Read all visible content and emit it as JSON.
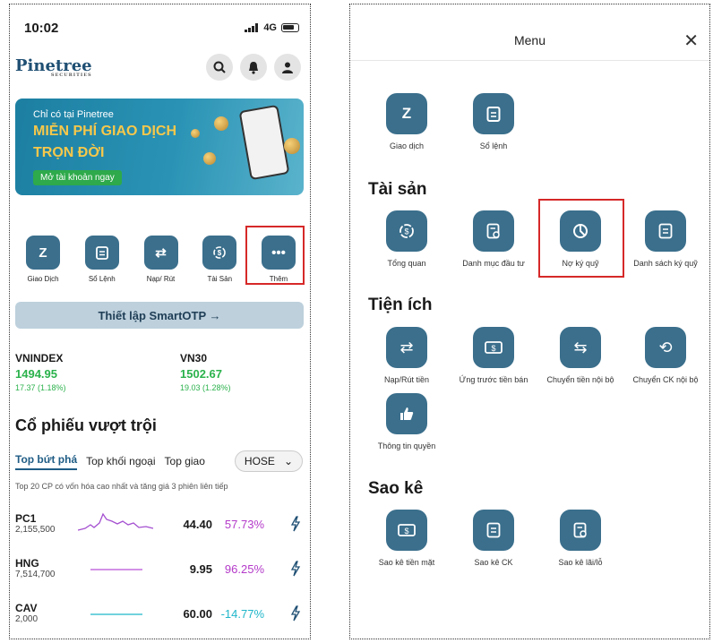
{
  "left": {
    "status_time": "10:02",
    "status_network": "4G",
    "logo": "Pinetree",
    "logo_sub": "SECURITIES",
    "banner": {
      "sub": "Chỉ có tại Pinetree",
      "line1": "MIỄN PHÍ GIAO DỊCH",
      "line2": "TRỌN ĐỜI",
      "cta": "Mở tài khoản ngay"
    },
    "quick_actions": [
      {
        "label": "Giao Dịch",
        "icon": "trade-icon"
      },
      {
        "label": "Sổ Lệnh",
        "icon": "orderbook-icon"
      },
      {
        "label": "Nạp/ Rút",
        "icon": "transfer-icon"
      },
      {
        "label": "Tài Sản",
        "icon": "asset-icon"
      },
      {
        "label": "Thêm",
        "icon": "more-icon"
      }
    ],
    "otp_button": "Thiết lập SmartOTP →",
    "indices": [
      {
        "name": "VNINDEX",
        "value": "1494.95",
        "change": "17.37 (1.18%)"
      },
      {
        "name": "VN30",
        "value": "1502.67",
        "change": "19.03 (1.28%)"
      }
    ],
    "section_title": "Cổ phiếu vượt trội",
    "tabs": [
      "Top bứt phá",
      "Top khối ngoại",
      "Top giao"
    ],
    "exchange": "HOSE",
    "hint": "Top 20 CP có vốn hóa cao nhất và tăng giá 3 phiên liên tiếp",
    "stocks": [
      {
        "symbol": "PC1",
        "volume": "2,155,500",
        "price": "44.40",
        "pct": "57.73%"
      },
      {
        "symbol": "HNG",
        "volume": "7,514,700",
        "price": "9.95",
        "pct": "96.25%"
      },
      {
        "symbol": "CAV",
        "volume": "2,000",
        "price": "60.00",
        "pct": "-14.77%"
      }
    ],
    "colors": {
      "accent": "#3b6f8c",
      "up": "#2bb24c",
      "highlight": "#d62828",
      "pct": "#b43ac9",
      "neg": "#1fb6c9"
    }
  },
  "right": {
    "title": "Menu",
    "close": "✕",
    "top_items": [
      {
        "label": "Giao dịch",
        "icon": "trade-icon"
      },
      {
        "label": "Sổ lệnh",
        "icon": "orderbook-icon"
      }
    ],
    "groups": [
      {
        "title": "Tài sản",
        "items": [
          {
            "label": "Tổng quan",
            "icon": "overview-icon"
          },
          {
            "label": "Danh mục đầu tư",
            "icon": "portfolio-icon"
          },
          {
            "label": "Nợ ký quỹ",
            "icon": "margin-debt-icon"
          },
          {
            "label": "Danh sách ký quỹ",
            "icon": "margin-list-icon"
          }
        ]
      },
      {
        "title": "Tiện ích",
        "items": [
          {
            "label": "Nạp/Rút tiền",
            "icon": "transfer-icon"
          },
          {
            "label": "Ứng trước tiền bán",
            "icon": "advance-icon"
          },
          {
            "label": "Chuyển tiền nội bộ",
            "icon": "internal-transfer-icon"
          },
          {
            "label": "Chuyển CK nội bộ",
            "icon": "stock-transfer-icon"
          },
          {
            "label": "Thông tin quyền",
            "icon": "rights-icon"
          }
        ]
      },
      {
        "title": "Sao kê",
        "items": [
          {
            "label": "Sao kê tiền mặt",
            "icon": "cash-statement-icon"
          },
          {
            "label": "Sao kê CK",
            "icon": "stock-statement-icon"
          },
          {
            "label": "Sao kê lãi/lỗ",
            "icon": "pnl-statement-icon"
          }
        ]
      }
    ]
  }
}
